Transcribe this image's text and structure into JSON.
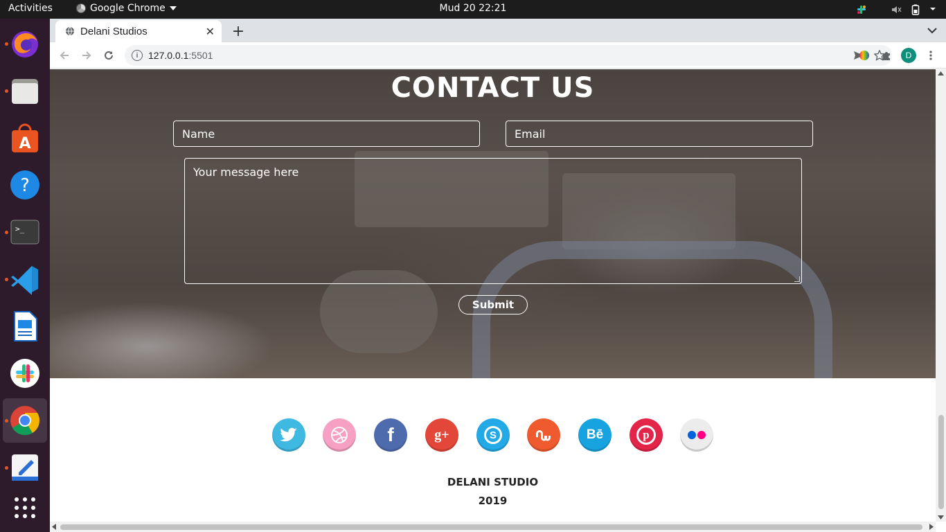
{
  "topbar": {
    "activities": "Activities",
    "app_name": "Google Chrome",
    "clock": "Mud 20  22:21"
  },
  "dock": {
    "items": [
      {
        "name": "firefox",
        "running": true
      },
      {
        "name": "files",
        "running": true
      },
      {
        "name": "software",
        "running": false
      },
      {
        "name": "help",
        "running": false
      },
      {
        "name": "terminal",
        "running": true
      },
      {
        "name": "vscode",
        "running": true
      },
      {
        "name": "libreoffice-impress",
        "running": false
      },
      {
        "name": "slack",
        "running": false
      },
      {
        "name": "chrome",
        "running": true,
        "active": true
      },
      {
        "name": "text-editor",
        "running": true
      },
      {
        "name": "show-apps",
        "running": false
      }
    ]
  },
  "browser": {
    "tab_title": "Delani Studios",
    "url_host": "127.0.0.1",
    "url_port": ":5501",
    "profile_initial": "D"
  },
  "contact": {
    "title": "CONTACT US",
    "name_placeholder": "Name",
    "email_placeholder": "Email",
    "message_placeholder": "Your message here",
    "submit_label": "Submit"
  },
  "footer": {
    "social": [
      {
        "name": "twitter",
        "color": "#3fb8e2"
      },
      {
        "name": "dribbble",
        "color": "#f6a0c3"
      },
      {
        "name": "facebook",
        "color": "#4e6cad"
      },
      {
        "name": "google-plus",
        "color": "#e2473a"
      },
      {
        "name": "skype",
        "color": "#22a9e6"
      },
      {
        "name": "stumbleupon",
        "color": "#ef5b2f"
      },
      {
        "name": "behance",
        "color": "#17a3e0"
      },
      {
        "name": "pinterest",
        "color": "#e3254a"
      },
      {
        "name": "flickr",
        "color": "#ececec"
      }
    ],
    "studio": "DELANI STUDIO",
    "year": "2019"
  }
}
